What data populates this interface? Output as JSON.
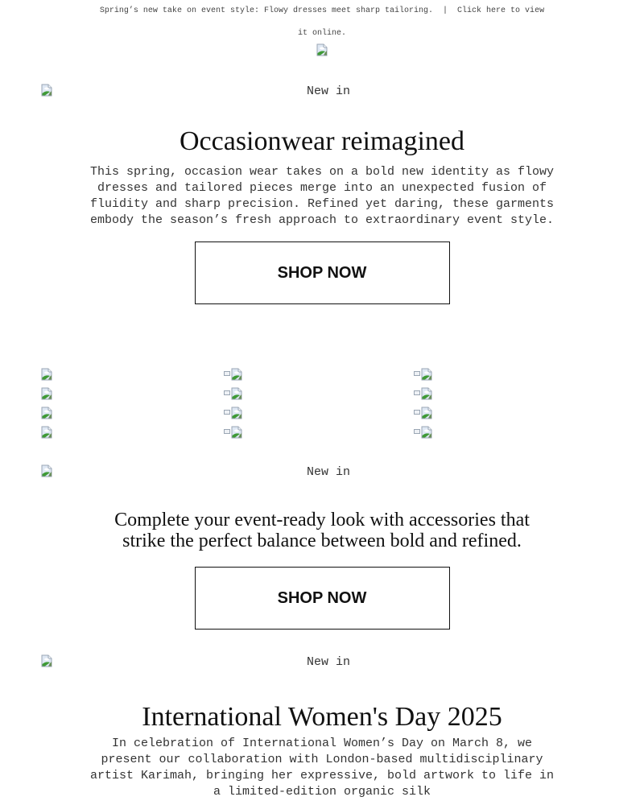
{
  "preheader": {
    "teaser": "Spring’s new take on event style: Flowy dresses meet sharp tailoring.",
    "separator": "|",
    "view_online": "Click here to view it online."
  },
  "icons": {
    "broken_image": "broken-image-icon"
  },
  "hero1": {
    "alt": "New in",
    "title": "Occasionwear reimagined",
    "body": "This spring, occasion wear takes on a bold new identity as flowy dresses and tailored pieces merge into an unexpected fusion of fluidity and sharp precision. Refined yet daring, these garments embody the season’s fresh approach to extraordinary event style.",
    "cta": "SHOP NOW"
  },
  "product_grid": {
    "rows": 4,
    "columns": 3
  },
  "hero2": {
    "alt": "New in",
    "title": "Complete your event-ready look with accessories that strike the perfect balance between bold and refined.",
    "cta": "SHOP NOW"
  },
  "hero3": {
    "alt": "New in",
    "title": "International Women's Day 2025",
    "body": "In celebration of International Women’s Day on March 8, we present our collaboration with London-based multidisciplinary artist Karimah, bringing her expressive, bold artwork to life in a limited-edition organic silk"
  }
}
